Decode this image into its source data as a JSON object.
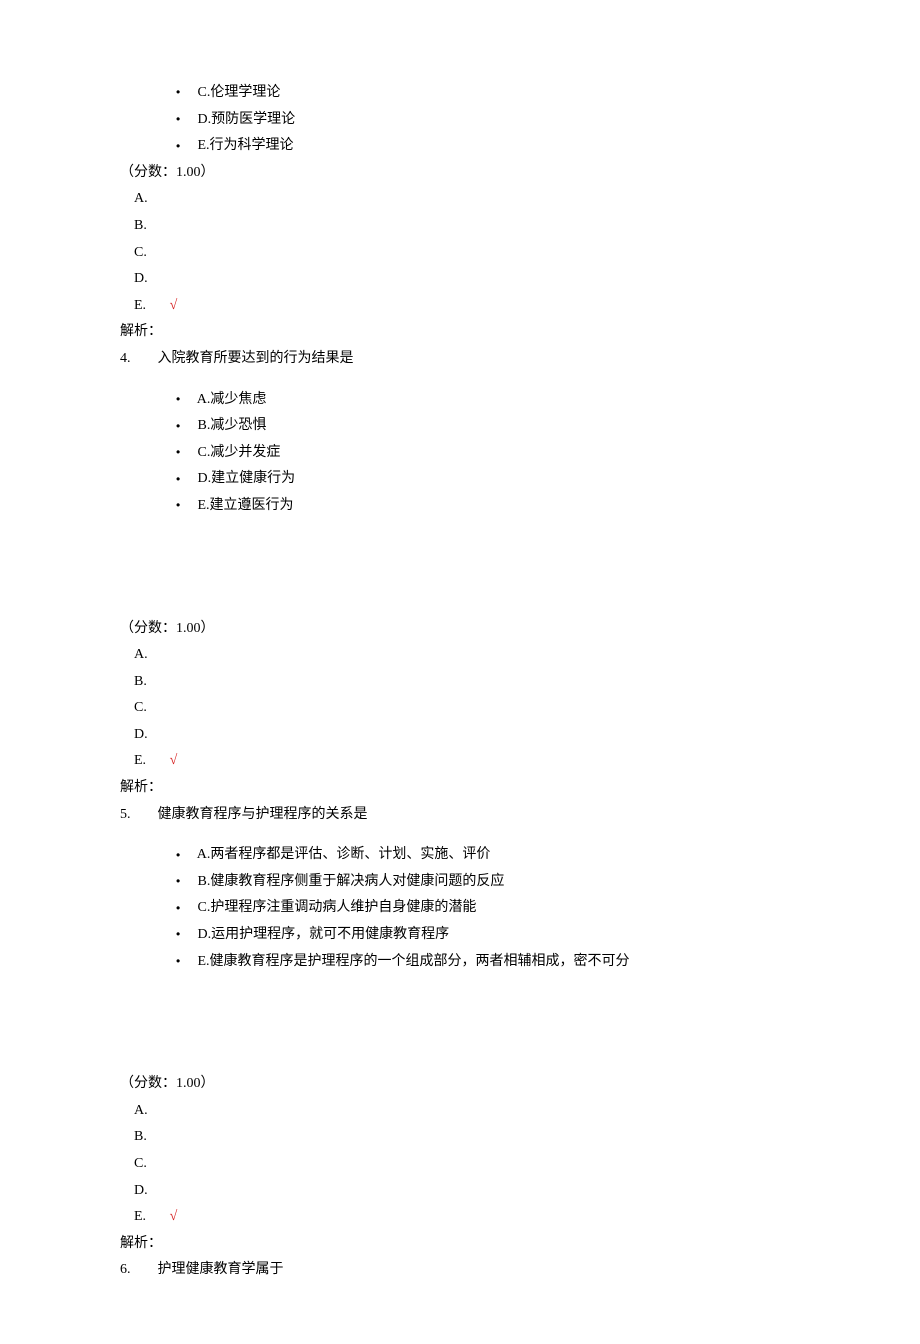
{
  "q3_tail_options": [
    {
      "label": "C.伦理学理论"
    },
    {
      "label": "D.预防医学理论"
    },
    {
      "label": "E.行为科学理论"
    }
  ],
  "q3_score": "（分数：1.00）",
  "q3_answers": [
    {
      "letter": "A.",
      "mark": ""
    },
    {
      "letter": "B.",
      "mark": ""
    },
    {
      "letter": "C.",
      "mark": ""
    },
    {
      "letter": "D.",
      "mark": ""
    },
    {
      "letter": "E.",
      "mark": "√"
    }
  ],
  "q3_analysis": "解析：",
  "q4_num": "4.",
  "q4_stem": "入院教育所要达到的行为结果是",
  "q4_options": [
    {
      "label": "A.减少焦虑"
    },
    {
      "label": "B.减少恐惧"
    },
    {
      "label": "C.减少并发症"
    },
    {
      "label": "D.建立健康行为"
    },
    {
      "label": "E.建立遵医行为"
    }
  ],
  "q4_score": "（分数：1.00）",
  "q4_answers": [
    {
      "letter": "A.",
      "mark": ""
    },
    {
      "letter": "B.",
      "mark": ""
    },
    {
      "letter": "C.",
      "mark": ""
    },
    {
      "letter": "D.",
      "mark": ""
    },
    {
      "letter": "E.",
      "mark": "√"
    }
  ],
  "q4_analysis": "解析：",
  "q5_num": "5.",
  "q5_stem": "健康教育程序与护理程序的关系是",
  "q5_options": [
    {
      "label": "A.两者程序都是评估、诊断、计划、实施、评价"
    },
    {
      "label": "B.健康教育程序侧重于解决病人对健康问题的反应"
    },
    {
      "label": "C.护理程序注重调动病人维护自身健康的潜能"
    },
    {
      "label": "D.运用护理程序，就可不用健康教育程序"
    },
    {
      "label": "E.健康教育程序是护理程序的一个组成部分，两者相辅相成，密不可分"
    }
  ],
  "q5_score": "（分数：1.00）",
  "q5_answers": [
    {
      "letter": "A.",
      "mark": ""
    },
    {
      "letter": "B.",
      "mark": ""
    },
    {
      "letter": "C.",
      "mark": ""
    },
    {
      "letter": "D.",
      "mark": ""
    },
    {
      "letter": "E.",
      "mark": "√"
    }
  ],
  "q5_analysis": "解析：",
  "q6_num": "6.",
  "q6_stem": "护理健康教育学属于",
  "bullet_glyph": "•"
}
